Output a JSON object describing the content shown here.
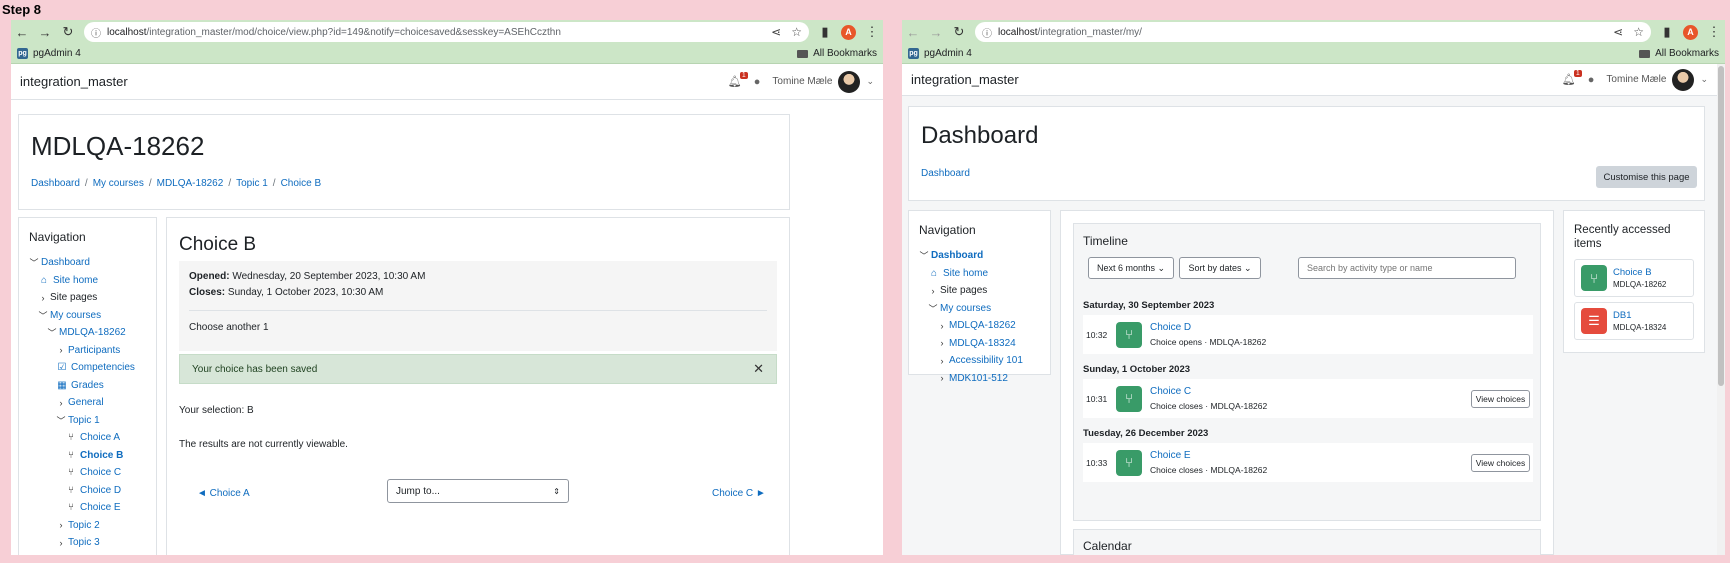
{
  "step_label": "Step 8",
  "left_browser": {
    "url_host": "localhost",
    "url_path": "/integration_master/mod/choice/view.php?id=149&notify=choicesaved&sesskey=ASEhCczthn",
    "profile_initial": "A",
    "bookmark_pgadmin": "pgAdmin 4",
    "bookmark_all": "All Bookmarks",
    "site_name": "integration_master",
    "notification_count": "1",
    "user_name": "Tomine Mæle",
    "course_title": "MDLQA-18262",
    "breadcrumb": [
      "Dashboard",
      "My courses",
      "MDLQA-18262",
      "Topic 1",
      "Choice B"
    ],
    "navigation": {
      "title": "Navigation",
      "items": [
        {
          "label": "Dashboard",
          "chev": "﹀",
          "icon": "",
          "style": "link",
          "indent": 0
        },
        {
          "label": "Site home",
          "chev": "",
          "icon": "⌂",
          "style": "link",
          "indent": 1
        },
        {
          "label": "Site pages",
          "chev": "›",
          "icon": "",
          "style": "plain",
          "indent": 1
        },
        {
          "label": "My courses",
          "chev": "﹀",
          "icon": "",
          "style": "link",
          "indent": 1
        },
        {
          "label": "MDLQA-18262",
          "chev": "﹀",
          "icon": "",
          "style": "link",
          "indent": 2
        },
        {
          "label": "Participants",
          "chev": "›",
          "icon": "",
          "style": "link",
          "indent": 3
        },
        {
          "label": "Competencies",
          "chev": "",
          "icon": "☑",
          "style": "link",
          "indent": 3
        },
        {
          "label": "Grades",
          "chev": "",
          "icon": "▦",
          "style": "link",
          "indent": 3
        },
        {
          "label": "General",
          "chev": "›",
          "icon": "",
          "style": "link",
          "indent": 3
        },
        {
          "label": "Topic 1",
          "chev": "﹀",
          "icon": "",
          "style": "link",
          "indent": 3
        },
        {
          "label": "Choice A",
          "chev": "",
          "icon": "⑂",
          "style": "link",
          "indent": 4
        },
        {
          "label": "Choice B",
          "chev": "",
          "icon": "⑂",
          "style": "bold",
          "indent": 4
        },
        {
          "label": "Choice C",
          "chev": "",
          "icon": "⑂",
          "style": "link",
          "indent": 4
        },
        {
          "label": "Choice D",
          "chev": "",
          "icon": "⑂",
          "style": "link",
          "indent": 4
        },
        {
          "label": "Choice E",
          "chev": "",
          "icon": "⑂",
          "style": "link",
          "indent": 4
        },
        {
          "label": "Topic 2",
          "chev": "›",
          "icon": "",
          "style": "link",
          "indent": 3
        },
        {
          "label": "Topic 3",
          "chev": "›",
          "icon": "",
          "style": "link",
          "indent": 3
        }
      ]
    },
    "activity": {
      "title": "Choice B",
      "opened_label": "Opened:",
      "opened_value": "Wednesday, 20 September 2023, 10:30 AM",
      "closes_label": "Closes:",
      "closes_value": "Sunday, 1 October 2023, 10:30 AM",
      "description": "Choose another 1",
      "alert": "Your choice has been saved",
      "selection": "Your selection: B",
      "results": "The results are not currently viewable.",
      "prev_link": "◄ Choice A",
      "jump_placeholder": "Jump to...",
      "next_link": "Choice C ►"
    }
  },
  "right_browser": {
    "url_host": "localhost",
    "url_path": "/integration_master/my/",
    "profile_initial": "A",
    "bookmark_pgadmin": "pgAdmin 4",
    "bookmark_all": "All Bookmarks",
    "site_name": "integration_master",
    "notification_count": "1",
    "user_name": "Tomine Mæle",
    "page_title": "Dashboard",
    "breadcrumb": "Dashboard",
    "customise_button": "Customise this page",
    "navigation": {
      "title": "Navigation",
      "items": [
        {
          "label": "Dashboard",
          "chev": "﹀",
          "icon": "",
          "style": "bold",
          "indent": 0
        },
        {
          "label": "Site home",
          "chev": "",
          "icon": "⌂",
          "style": "link",
          "indent": 1
        },
        {
          "label": "Site pages",
          "chev": "›",
          "icon": "",
          "style": "plain",
          "indent": 1
        },
        {
          "label": "My courses",
          "chev": "﹀",
          "icon": "",
          "style": "link",
          "indent": 1
        },
        {
          "label": "MDLQA-18262",
          "chev": "›",
          "icon": "",
          "style": "link",
          "indent": 2
        },
        {
          "label": "MDLQA-18324",
          "chev": "›",
          "icon": "",
          "style": "link",
          "indent": 2
        },
        {
          "label": "Accessibility 101",
          "chev": "›",
          "icon": "",
          "style": "link",
          "indent": 2
        },
        {
          "label": "MDK101-512",
          "chev": "›",
          "icon": "",
          "style": "link",
          "indent": 2
        }
      ]
    },
    "timeline": {
      "title": "Timeline",
      "range_select": "Next 6 months",
      "sort_select": "Sort by dates",
      "search_placeholder": "Search by activity type or name",
      "groups": [
        {
          "date": "Saturday, 30 September 2023",
          "time": "10:32",
          "name": "Choice D",
          "detail": "Choice opens",
          "course": "MDLQA-18262",
          "button": ""
        },
        {
          "date": "Sunday, 1 October 2023",
          "time": "10:31",
          "name": "Choice C",
          "detail": "Choice closes",
          "course": "MDLQA-18262",
          "button": "View choices"
        },
        {
          "date": "Tuesday, 26 December 2023",
          "time": "10:33",
          "name": "Choice E",
          "detail": "Choice closes",
          "course": "MDLQA-18262",
          "button": "View choices"
        }
      ]
    },
    "calendar_title": "Calendar",
    "recent": {
      "title": "Recently accessed items",
      "items": [
        {
          "name": "Choice B",
          "course": "MDLQA-18262",
          "icon": "choice-icon",
          "color": "#399b68"
        },
        {
          "name": "DB1",
          "course": "MDLQA-18324",
          "icon": "database-icon",
          "color": "#e54b3d"
        }
      ]
    }
  }
}
